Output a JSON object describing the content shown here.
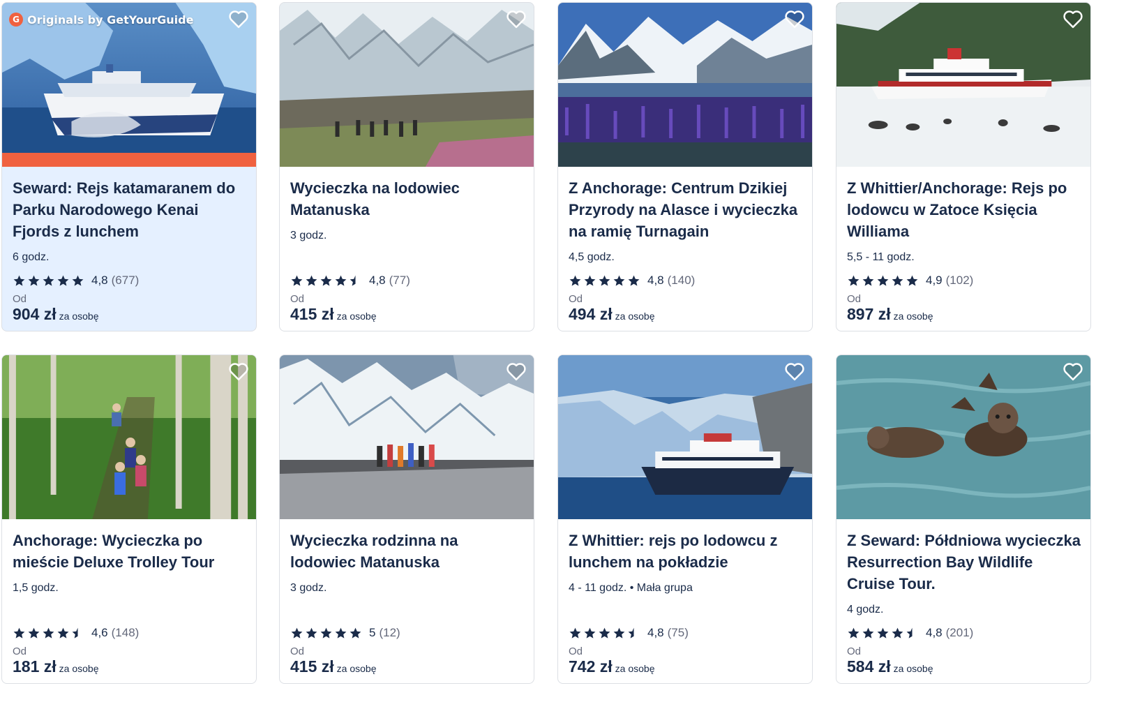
{
  "originals_label": "Originals by GetYourGuide",
  "originals_logo_letter": "G",
  "colors": {
    "title": "#1a2b49",
    "accent": "#f0613f",
    "featured_bg": "#e5f0ff",
    "border": "#dcdfe4"
  },
  "cards": [
    {
      "title": "Seward: Rejs katamaranem do Parku Narodowego Kenai Fjords z lunchem",
      "duration": "6 godz.",
      "rating": "4,8",
      "count": "(677)",
      "stars": 5,
      "from": "Od",
      "price": "904 zł",
      "per": "za osobę",
      "image": "boat-glacier-image"
    },
    {
      "title": "Wycieczka na lodowiec Matanuska",
      "duration": "3 godz.",
      "rating": "4,8",
      "count": "(77)",
      "stars": 4.5,
      "from": "Od",
      "price": "415 zł",
      "per": "za osobę",
      "image": "glacier-hikers-image"
    },
    {
      "title": "Z Anchorage: Centrum Dzikiej Przyrody na Alasce i wycieczka na ramię Turnagain",
      "duration": "4,5 godz.",
      "rating": "4,8",
      "count": "(140)",
      "stars": 5,
      "from": "Od",
      "price": "494 zł",
      "per": "za osobę",
      "image": "mountains-lupine-image"
    },
    {
      "title": "Z Whittier/Anchorage: Rejs po lodowcu w Zatoce Księcia Williama",
      "duration": "5,5 - 11 godz.",
      "rating": "4,9",
      "count": "(102)",
      "stars": 5,
      "from": "Od",
      "price": "897 zł",
      "per": "za osobę",
      "image": "cruise-ship-ice-image"
    },
    {
      "title": "Anchorage: Wycieczka po mieście Deluxe Trolley Tour",
      "duration": "1,5 godz.",
      "rating": "4,6",
      "count": "(148)",
      "stars": 4.5,
      "from": "Od",
      "price": "181 zł",
      "per": "za osobę",
      "image": "forest-hikers-image"
    },
    {
      "title": "Wycieczka rodzinna na lodowiec Matanuska",
      "duration": "3 godz.",
      "rating": "5",
      "count": "(12)",
      "stars": 5,
      "from": "Od",
      "price": "415 zł",
      "per": "za osobę",
      "image": "glacier-group-image"
    },
    {
      "title": "Z Whittier: rejs po lodowcu z lunchem na pokładzie",
      "duration": "4 - 11 godz. • Mała grupa",
      "rating": "4,8",
      "count": "(75)",
      "stars": 4.5,
      "from": "Od",
      "price": "742 zł",
      "per": "za osobę",
      "image": "boat-glacier-bay-image"
    },
    {
      "title": "Z Seward: Półdniowa wycieczka Resurrection Bay Wildlife Cruise Tour.",
      "duration": "4 godz.",
      "rating": "4,8",
      "count": "(201)",
      "stars": 4.5,
      "from": "Od",
      "price": "584 zł",
      "per": "za osobę",
      "image": "sea-otters-image"
    }
  ]
}
